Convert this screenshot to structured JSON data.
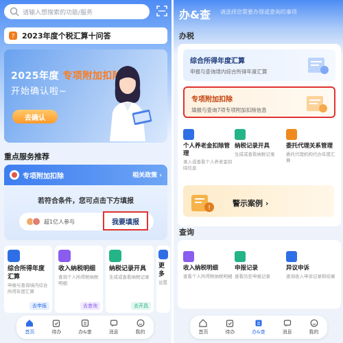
{
  "left": {
    "search_placeholder": "请输入想搜索的功能/服务",
    "faq_title": "2023年度个税汇算十问答",
    "banner": {
      "title_prefix": "2025年度",
      "title_highlight": "专项附加扣除",
      "subtitle": "开始确认啦~",
      "button": "去确认"
    },
    "section_title": "重点服务推荐",
    "service": {
      "title": "专项附加扣除",
      "policy": "相关政策",
      "condition": "若符合条件，您可点击下方填报",
      "participants": "超1亿人参与",
      "action": "我要填报"
    },
    "cards": [
      {
        "name": "综合所得年度汇算",
        "desc": "申报与查询境内综合所得年度汇算",
        "tag": "去申报",
        "color": "#2f6fe6"
      },
      {
        "name": "收入纳税明细",
        "desc": "查询个人所得税纳税明细",
        "tag": "去查询",
        "color": "#8a5cf0"
      },
      {
        "name": "纳税记录开具",
        "desc": "生成或查看纳税记录",
        "tag": "去开具",
        "color": "#24b487"
      },
      {
        "name": "更多",
        "desc": "设置",
        "tag": "",
        "color": "#2f6fe6"
      }
    ]
  },
  "tabs": [
    "首页",
    "待办",
    "办&查",
    "消息",
    "我的"
  ],
  "right": {
    "title": "办&查",
    "subtitle": "请选择您需要办理或查询的事项",
    "section_tax": "办税",
    "annual": {
      "name": "综合所得年度汇算",
      "desc": "申报与查询境内综合所得年度汇算"
    },
    "special": {
      "name": "专项附加扣除",
      "desc": "填报与查询7项专项附加扣除信息"
    },
    "grid": [
      {
        "name": "个人养老金扣除管理",
        "desc": "录入或查看个人养老金扣除信息",
        "color": "#2f6fe6"
      },
      {
        "name": "纳税记录开具",
        "desc": "生成或查看纳税记录",
        "color": "#24b487"
      },
      {
        "name": "委托代理关系管理",
        "desc": "委托代理机构代办年度汇算",
        "color": "#f08a1c"
      }
    ],
    "warning": "警示案例",
    "section_query": "查询",
    "query": [
      {
        "name": "收入纳税明细",
        "desc": "查看个人所得税纳税明细",
        "color": "#8a5cf0"
      },
      {
        "name": "申报记录",
        "desc": "查看历史申报记录",
        "color": "#24b487"
      },
      {
        "name": "异议申诉",
        "desc": "查询收入申诉记录和结果",
        "color": "#2f6fe6"
      }
    ]
  }
}
